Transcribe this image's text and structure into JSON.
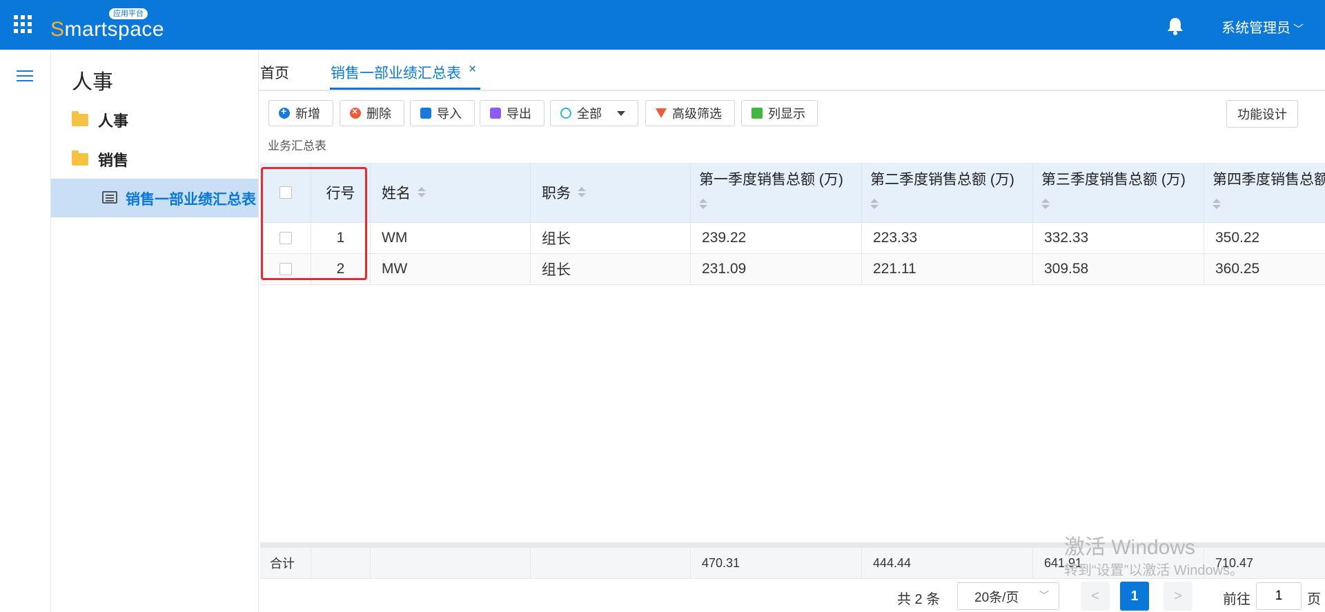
{
  "header": {
    "logo_s": "S",
    "logo_rest": "martspace",
    "logo_badge": "应用平台",
    "user": "系统管理员"
  },
  "sidebar": {
    "title": "人事",
    "items": [
      {
        "label": "人事"
      },
      {
        "label": "销售"
      },
      {
        "label": "销售一部业绩汇总表"
      }
    ]
  },
  "tabs": {
    "home": "首页",
    "active": "销售一部业绩汇总表",
    "close": "×"
  },
  "toolbar": {
    "add": "新增",
    "delete": "删除",
    "import": "导入",
    "export": "导出",
    "all": "全部",
    "advanced_filter": "高级筛选",
    "columns": "列显示",
    "design": "功能设计"
  },
  "subtitle": "业务汇总表",
  "table": {
    "headers": [
      "行号",
      "姓名",
      "职务",
      "第一季度销售总额 (万)",
      "第二季度销售总额 (万)",
      "第三季度销售总额 (万)",
      "第四季度销售总额"
    ],
    "rows": [
      [
        "1",
        "WM",
        "组长",
        "239.22",
        "223.33",
        "332.33",
        "350.22"
      ],
      [
        "2",
        "MW",
        "组长",
        "231.09",
        "221.11",
        "309.58",
        "360.25"
      ]
    ],
    "sum_label": "合计",
    "sums": [
      "470.31",
      "444.44",
      "641.91",
      "710.47"
    ]
  },
  "pagination": {
    "total": "共 2 条",
    "page_size": "20条/页",
    "current": "1",
    "prev": "<",
    "next": ">",
    "goto_label": "前往",
    "goto_value": "1",
    "page_suffix": "页"
  },
  "watermark": {
    "line1": "激活 Windows",
    "line2": "转到“设置”以激活 Windows。"
  },
  "colors": {
    "brand": "#0a78d8",
    "highlight_box": "#e8292f",
    "sidebar_active": "#c8dff5"
  }
}
